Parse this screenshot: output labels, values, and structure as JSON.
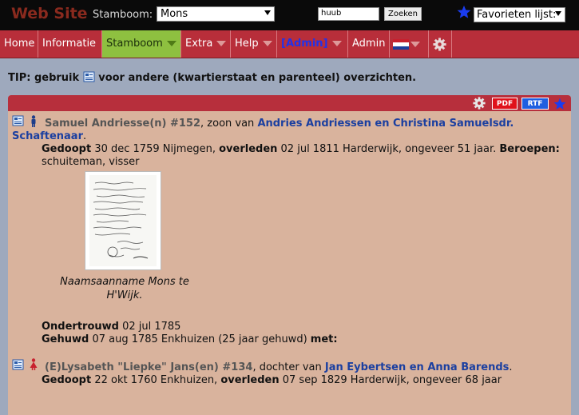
{
  "header": {
    "site_title": "Web Site",
    "stamboom_label": "Stamboom:",
    "stamboom_value": "Mons",
    "search_value": "huub",
    "search_button": "Zoeken",
    "favorites_value": "Favorieten lijst:"
  },
  "nav": {
    "items": [
      "Home",
      "Informatie",
      "Stamboom",
      "Extra",
      "Help",
      "[Admin]",
      "Admin"
    ]
  },
  "tip": {
    "prefix": "TIP: gebruik",
    "suffix": "voor andere (kwartierstaat en parenteel) overzichten."
  },
  "panel": {
    "pdf": "PDF",
    "rtf": "RTF"
  },
  "person1": {
    "name": "Samuel Andriesse(n) #152",
    "relation": ", zoon van ",
    "parents_line1": "Andries Andriessen en Christina Samuelsdr.",
    "parents_line2": "Schaftenaar",
    "period": ".",
    "gedoopt_label": "Gedoopt",
    "gedoopt_value": " 30 dec 1759 Nijmegen, ",
    "overleden_label": "overleden",
    "overleden_value": " 02 jul 1811 Harderwijk, ongeveer 51 jaar. ",
    "beroepen_label": "Beroepen:",
    "beroepen_value": "schuiteman, visser",
    "photo_caption": "Naamsaanname Mons te H'Wijk.",
    "ondertrouwd_label": "Ondertrouwd",
    "ondertrouwd_value": " 02 jul 1785",
    "gehuwd_label": "Gehuwd",
    "gehuwd_value": " 07 aug 1785 Enkhuizen (25 jaar gehuwd) ",
    "met_label": "met:"
  },
  "person2": {
    "name": "(E)Lysabeth \"Liepke\" Jans(en) #134",
    "relation": ", dochter van ",
    "parents": "Jan Eybertsen en Anna Barends",
    "period": ".",
    "gedoopt_label": "Gedoopt",
    "gedoopt_value": " 22 okt 1760 Enkhuizen, ",
    "overleden_label": "overleden",
    "overleden_value": " 07 sep 1829 Harderwijk, ongeveer 68 jaar"
  },
  "colors": {
    "topbar": "#0a0a0a",
    "site_title": "#8a2a1e",
    "nav": "#b82e3a",
    "nav_active": "#8ec040",
    "page_bg": "#9ea9bd",
    "panel_bg": "#d9b39d",
    "link": "#1b3fa0"
  }
}
